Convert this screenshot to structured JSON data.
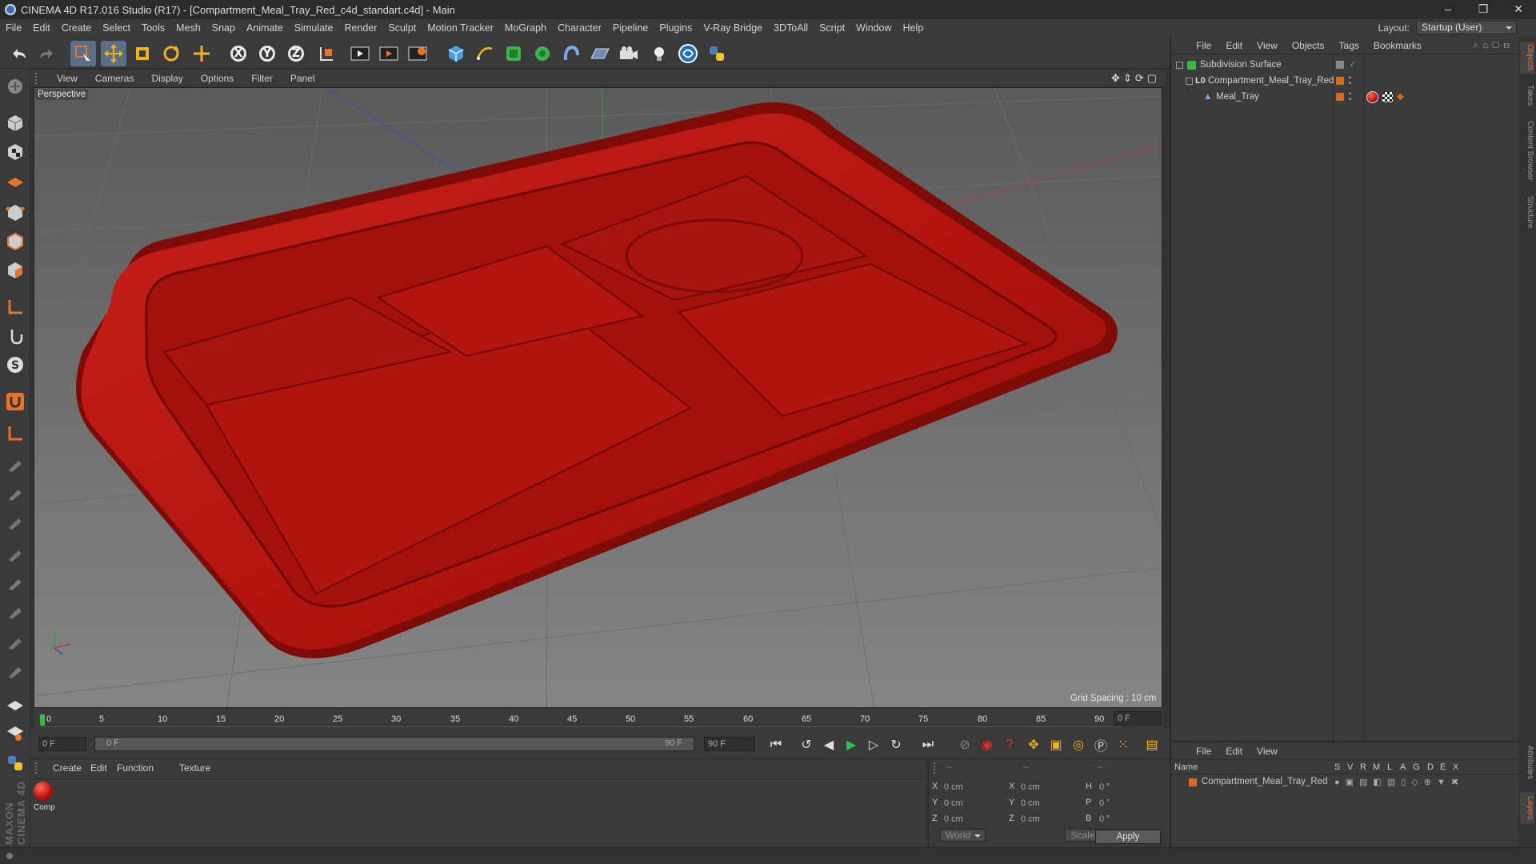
{
  "window": {
    "title": "CINEMA 4D R17.016 Studio (R17) - [Compartment_Meal_Tray_Red_c4d_standart.c4d] - Main",
    "controls": [
      "–",
      "❐",
      "✕"
    ]
  },
  "menubar": {
    "items": [
      "File",
      "Edit",
      "Create",
      "Select",
      "Tools",
      "Mesh",
      "Snap",
      "Animate",
      "Simulate",
      "Render",
      "Sculpt",
      "Motion Tracker",
      "MoGraph",
      "Character",
      "Pipeline",
      "Plugins",
      "V-Ray Bridge",
      "3DToAll",
      "Script",
      "Window",
      "Help"
    ],
    "layout_label": "Layout:",
    "layout_value": "Startup (User)"
  },
  "toolbar": {
    "axis_x": "X",
    "axis_y": "Y",
    "axis_z": "Z"
  },
  "viewport": {
    "menu": [
      "View",
      "Cameras",
      "Display",
      "Options",
      "Filter",
      "Panel"
    ],
    "label": "Perspective",
    "grid_spacing": "Grid Spacing : 10 cm"
  },
  "timeline": {
    "ticks": [
      "0",
      "5",
      "10",
      "15",
      "20",
      "25",
      "30",
      "35",
      "40",
      "45",
      "50",
      "55",
      "60",
      "65",
      "70",
      "75",
      "80",
      "85",
      "90"
    ],
    "current_frame": "0 F",
    "start_field": "0 F",
    "range_start": "0 F",
    "range_end": "90 F",
    "end_field": "90 F"
  },
  "material_manager": {
    "menu": [
      "Create",
      "Edit",
      "Function",
      "Texture"
    ],
    "material_label": "Comp"
  },
  "coordinates": {
    "header": [
      "--",
      "--",
      "--"
    ],
    "rows": [
      {
        "a": "X",
        "av": "0 cm",
        "b": "X",
        "bv": "0 cm",
        "c": "H",
        "cv": "0 °"
      },
      {
        "a": "Y",
        "av": "0 cm",
        "b": "Y",
        "bv": "0 cm",
        "c": "P",
        "cv": "0 °"
      },
      {
        "a": "Z",
        "av": "0 cm",
        "b": "Z",
        "bv": "0 cm",
        "c": "B",
        "cv": "0 °"
      }
    ],
    "world": "World",
    "scale": "Scale",
    "apply": "Apply"
  },
  "objects_panel": {
    "menu": [
      "File",
      "Edit",
      "View",
      "Objects",
      "Tags",
      "Bookmarks"
    ],
    "items": [
      {
        "name": "Subdivision Surface",
        "indent": 0
      },
      {
        "name": "Compartment_Meal_Tray_Red",
        "indent": 1
      },
      {
        "name": "Meal_Tray",
        "indent": 2
      }
    ]
  },
  "layers_panel": {
    "menu": [
      "File",
      "Edit",
      "View"
    ],
    "name_header": "Name",
    "flag_headers": [
      "S",
      "V",
      "R",
      "M",
      "L",
      "A",
      "G",
      "D",
      "E",
      "X"
    ],
    "layer_name": "Compartment_Meal_Tray_Red"
  },
  "side_tabs": [
    "Objects",
    "Takes",
    "Content Browser",
    "Structure",
    "Attributes",
    "Layers"
  ],
  "brand": "MAXON CINEMA 4D",
  "colors": {
    "tray_red": "#b5140f",
    "accent_blue": "#5a6e86",
    "orange_tag": "#d96a1c"
  }
}
